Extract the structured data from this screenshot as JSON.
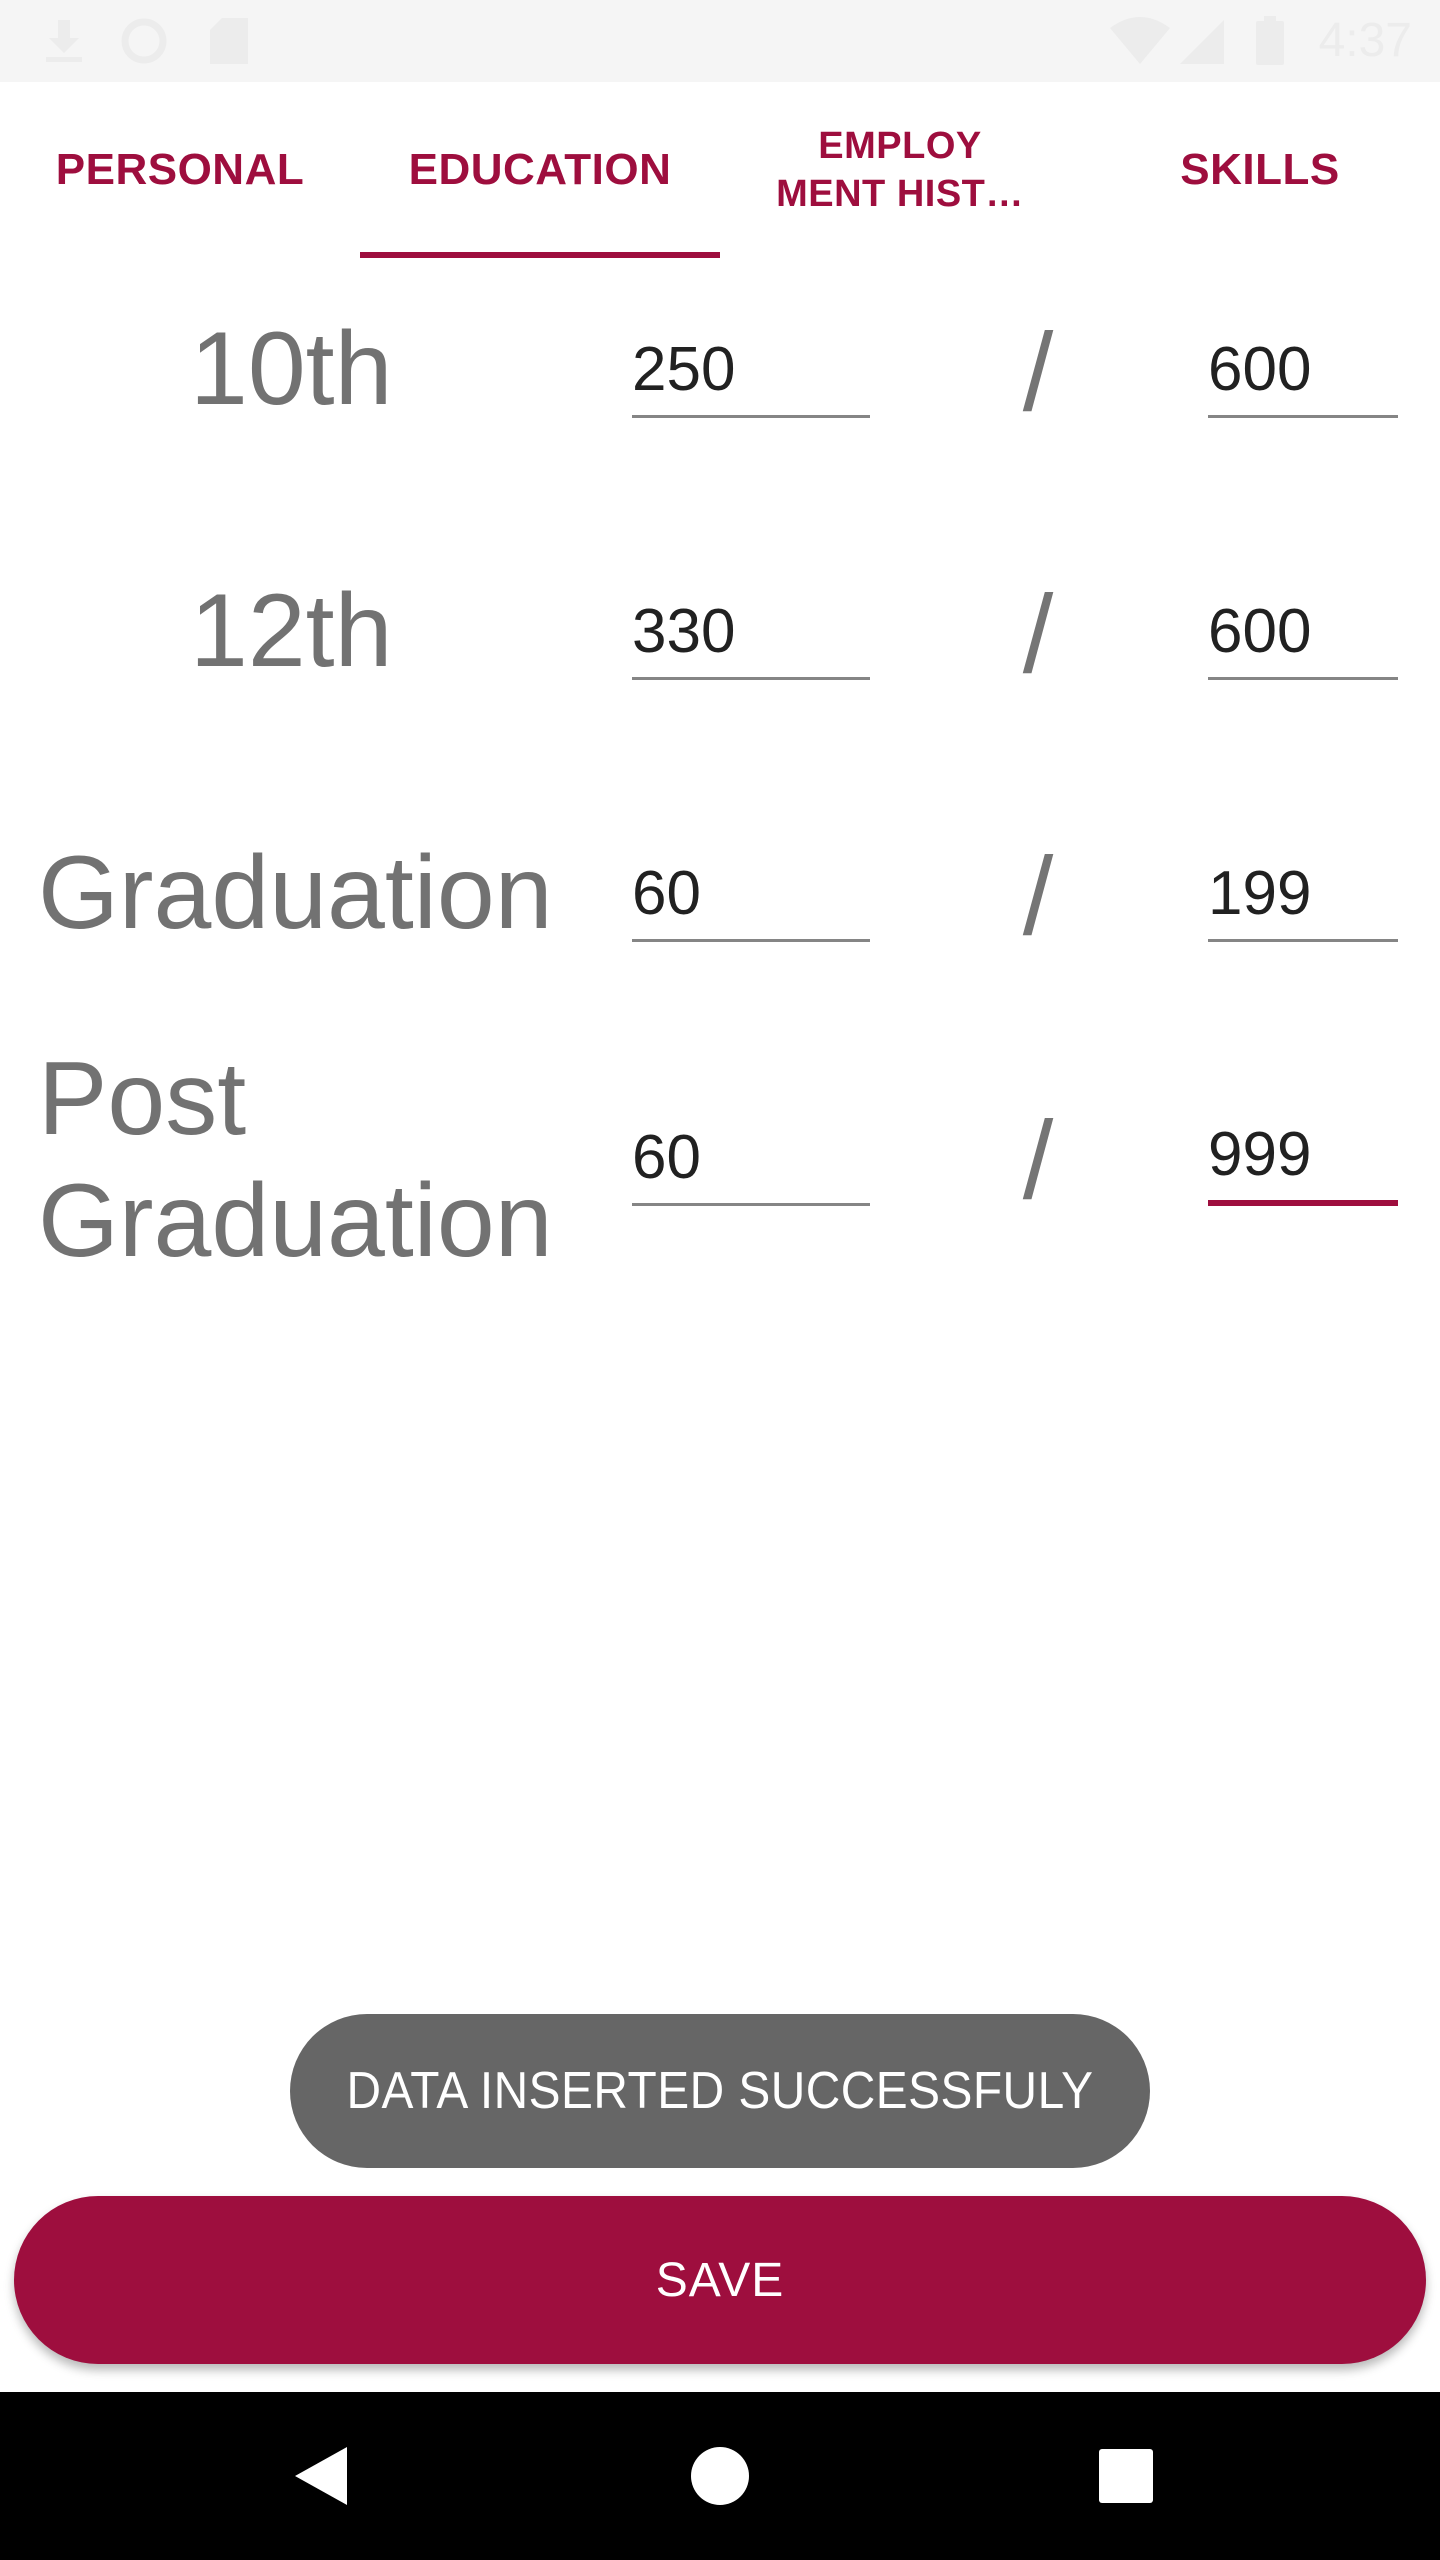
{
  "status_bar": {
    "time": "4:37",
    "icons": [
      "download-icon",
      "sync-icon",
      "sd-card-icon",
      "wifi-icon",
      "signal-icon",
      "battery-icon"
    ]
  },
  "tabs": [
    {
      "label": "PERSONAL",
      "selected": false
    },
    {
      "label": "EDUCATION",
      "selected": true
    },
    {
      "label_line1": "EMPLOY",
      "label_line2": "MENT HIST…",
      "selected": false
    },
    {
      "label": "SKILLS",
      "selected": false
    }
  ],
  "rows": [
    {
      "label": "10th",
      "obtained": "250",
      "separator": "/",
      "total": "600"
    },
    {
      "label": "12th",
      "obtained": "330",
      "separator": "/",
      "total": "600"
    },
    {
      "label": "Graduation",
      "obtained": "60",
      "separator": "/",
      "total": "199"
    },
    {
      "label_line1": "Post",
      "label_line2": "Graduation",
      "obtained": "60",
      "separator": "/",
      "total": "999"
    }
  ],
  "toast": {
    "text": "DATA INSERTED SUCCESSFULY"
  },
  "save_button": {
    "label": "SAVE"
  },
  "nav_bar": {
    "icons": [
      "back-icon",
      "home-icon",
      "recents-icon"
    ]
  },
  "colors": {
    "accent": "#9e0e3e",
    "toast_bg": "#666666",
    "label_gray": "#727272",
    "nav_bg": "#000000"
  }
}
